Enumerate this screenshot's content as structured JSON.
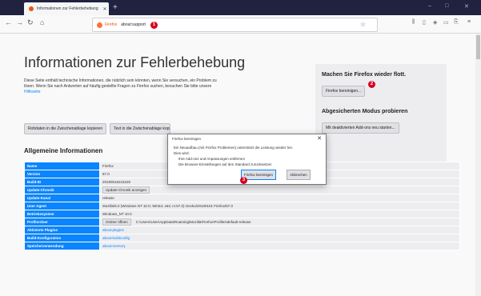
{
  "tab": {
    "title": "Informationen zur Fehlerbehebung",
    "close": "✕"
  },
  "newtab": "+",
  "window": {
    "minimize": "–",
    "maximize": "□",
    "close": "✕"
  },
  "nav": {
    "back": "←",
    "forward": "→",
    "reload": "↻",
    "home": "⌂"
  },
  "url": {
    "brand": "Firefox",
    "value": "about:support",
    "marker": "1",
    "star": "☆"
  },
  "toolbar_icons": {
    "library": "⫼",
    "sidebar": "▯",
    "shield": "◈",
    "sync": "▭",
    "shot": "⎘",
    "menu": "≡"
  },
  "page": {
    "heading": "Informationen zur Fehlerbehebung",
    "intro_line1": "Diese Seite enthält technische Informationen, die nützlich sein könnten, wenn Sie versuchen, ein Problem zu",
    "intro_line2": "lösen. Wenn Sie nach Antworten auf häufig gestellte Fragen zu Firefox suchen, besuchen Sie bitte unsere",
    "intro_link": "Hilfeseite",
    "copy_raw_button": "Rohdaten in die Zwischenablage kopieren",
    "copy_text_button": "Text in die Zwischenablage kopieren",
    "section_heading": "Allgemeine Informationen"
  },
  "sidebox": {
    "refresh_title": "Machen Sie Firefox wieder flott.",
    "refresh_button": "Firefox bereinigen...",
    "refresh_marker": "2",
    "safe_title": "Abgesicherten Modus probieren",
    "safe_button": "Mit deaktivierten Add-ons neu starten..."
  },
  "table": {
    "rows": [
      {
        "k": "Name",
        "v": "Firefox"
      },
      {
        "k": "Version",
        "v": "67.0"
      },
      {
        "k": "Build-ID",
        "v": "20190516215225"
      },
      {
        "k": "Update-Chronik",
        "v": "Update-Chronik anzeigen"
      },
      {
        "k": "Update-Kanal",
        "v": "release"
      },
      {
        "k": "User Agent",
        "v": "Mozilla/5.0 (Windows NT 10.0; Win64; x64; rv:67.0) Gecko/20100101 Firefox/67.0"
      },
      {
        "k": "Betriebssystem",
        "v": "Windows_NT 10.0"
      },
      {
        "k": "Profilordner",
        "v": "C:\\Users\\User\\AppData\\Roaming\\Mozilla\\Firefox\\Profiles\\default-release",
        "btn": "Ordner öffnen"
      },
      {
        "k": "Aktivierte Plugins",
        "v": "about:plugins"
      },
      {
        "k": "Build-Konfiguration",
        "v": "about:buildconfig"
      },
      {
        "k": "Speicherverwendung",
        "v": "about:memory"
      }
    ]
  },
  "dialog": {
    "title": "Firefox bereinigen",
    "close": "✕",
    "line1": "Ein Neuaufbau (mit Firefox Problemen) unterstützt die Leistung wieder her.",
    "line2": "Dies wird:",
    "line3": "Ihre Add-ons und Anpassungen entfernen",
    "line4": "Die Browser-Einstellungen auf den Standard zurücksetzen",
    "confirm_button": "Firefox bereinigen",
    "cancel_button": "Abbrechen",
    "marker": "3"
  }
}
